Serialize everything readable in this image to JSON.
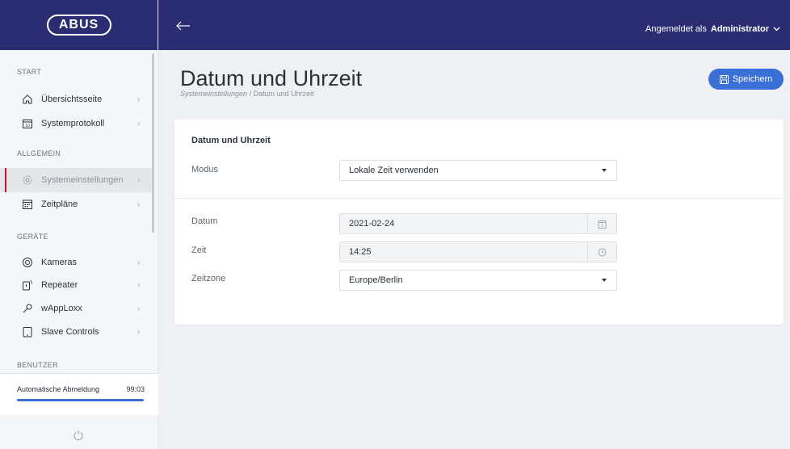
{
  "app": {
    "logo_text": "ABUS"
  },
  "header": {
    "logged_in_prefix": "Angemeldet als",
    "user": "Administrator"
  },
  "sidebar": {
    "sections": {
      "start": "START",
      "allgemein": "ALLGEMEIN",
      "geraete": "GERÄTE",
      "benutzer": "BENUTZER"
    },
    "items": [
      {
        "label": "Übersichtsseite",
        "icon": "home-icon"
      },
      {
        "label": "Systemprotokoll",
        "icon": "calendar-icon"
      },
      {
        "label": "Systemeinstellungen",
        "icon": "gear-icon",
        "active": true
      },
      {
        "label": "Zeitpläne",
        "icon": "schedule-icon"
      },
      {
        "label": "Kameras",
        "icon": "camera-icon"
      },
      {
        "label": "Repeater",
        "icon": "repeater-icon"
      },
      {
        "label": "wAppLoxx",
        "icon": "key-icon"
      },
      {
        "label": "Slave Controls",
        "icon": "tablet-icon"
      }
    ],
    "auto_logout": {
      "label": "Automatische Abmeldung",
      "time": "99:03",
      "progress": 1.0
    }
  },
  "main": {
    "title": "Datum und Uhrzeit",
    "breadcrumb": [
      "Systemeinstellungen",
      "/",
      "Datum und Uhrzeit"
    ],
    "save_label": "Speichern",
    "card": {
      "title": "Datum und Uhrzeit",
      "modus_label": "Modus",
      "modus_value": "Lokale Zeit verwenden",
      "datum_label": "Datum",
      "datum_value": "2021-02-24",
      "zeit_label": "Zeit",
      "zeit_value": "14:25",
      "zeitzone_label": "Zeitzone",
      "zeitzone_value": "Europe/Berlin"
    }
  },
  "colors": {
    "header_bg": "#2b2d73",
    "accent": "#3a6fd8",
    "active_marker": "#c0182c"
  }
}
